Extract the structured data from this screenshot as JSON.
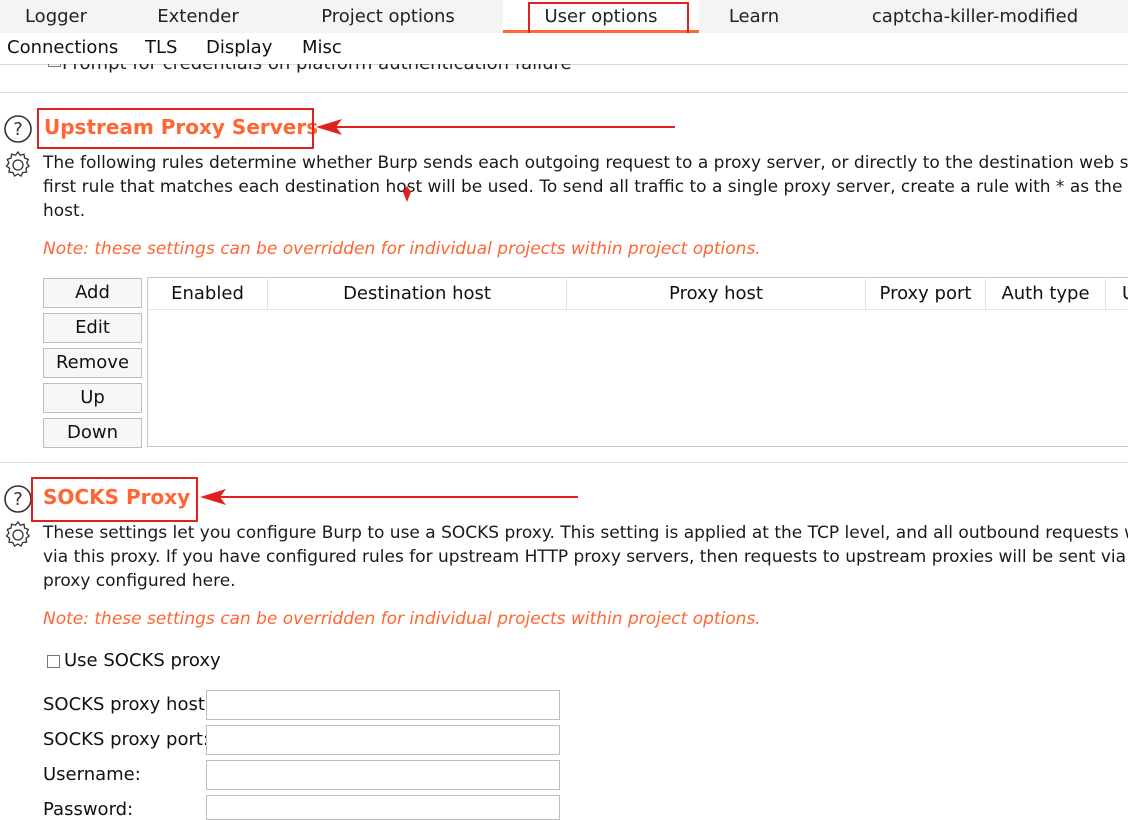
{
  "top_tabs": [
    "Logger",
    "Extender",
    "Project options",
    "User options",
    "Learn",
    "captcha-killer-modified"
  ],
  "active_top_tab": "User options",
  "sub_tabs": [
    "Connections",
    "TLS",
    "Display",
    "Misc"
  ],
  "clipped_option": "Prompt for credentials on platform authentication failure",
  "upstream": {
    "title": "Upstream Proxy Servers",
    "desc_line1": "The following rules determine whether Burp sends each outgoing request to a proxy server, or directly to the destination web s",
    "desc_line2": "first rule that matches each destination host will be used. To send all traffic to a single proxy server, create a rule with * as the d",
    "desc_line3": "host.",
    "note": "Note: these settings can be overridden for individual projects within project options.",
    "buttons": [
      "Add",
      "Edit",
      "Remove",
      "Up",
      "Down"
    ],
    "columns": [
      "Enabled",
      "Destination host",
      "Proxy host",
      "Proxy port",
      "Auth type",
      "U"
    ]
  },
  "socks": {
    "title": "SOCKS Proxy",
    "desc_line1": "These settings let you configure Burp to use a SOCKS proxy. This setting is applied at the TCP level, and all outbound requests w",
    "desc_line2": "via this proxy. If you have configured rules for upstream HTTP proxy servers, then requests to upstream proxies will be sent via t",
    "desc_line3": "proxy configured here.",
    "note": "Note: these settings can be overridden for individual projects within project options.",
    "use_socks_label": "Use SOCKS proxy",
    "use_socks_checked": false,
    "fields": [
      {
        "label": "SOCKS proxy host:",
        "value": ""
      },
      {
        "label": "SOCKS proxy port:",
        "value": ""
      },
      {
        "label": "Username:",
        "value": ""
      },
      {
        "label": "Password:",
        "value": ""
      }
    ]
  },
  "colors": {
    "accent": "#ff6633",
    "annotation": "#e0211f"
  },
  "icons": [
    "help-circle-icon",
    "gear-icon"
  ]
}
